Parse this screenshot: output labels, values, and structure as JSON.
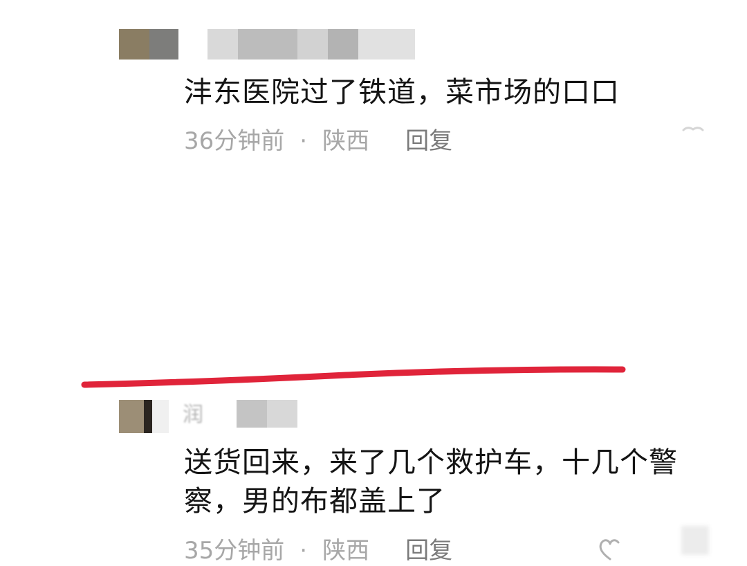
{
  "comments": [
    {
      "text": "沣东医院过了铁道，菜市场的口口",
      "time": "36分钟前",
      "separator": "·",
      "location": "陕西",
      "reply_label": "回复"
    },
    {
      "name_initial": "润",
      "text": "送货回来，来了几个救护车，十几个警察，男的布都盖上了",
      "time": "35分钟前",
      "separator": "·",
      "location": "陕西",
      "reply_label": "回复"
    }
  ],
  "colors": {
    "body_text": "#141414",
    "meta_text": "#a7a7a7",
    "underline": "#e0243a"
  }
}
